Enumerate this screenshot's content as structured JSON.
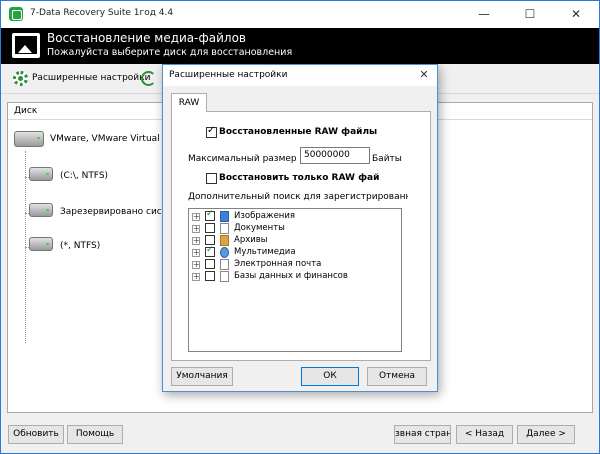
{
  "window": {
    "title": "7-Data Recovery Suite 1год 4.4",
    "minimize": "—",
    "maximize": "☐",
    "close": "✕"
  },
  "header": {
    "title": "Восстановление медиа-файлов",
    "subtitle": "Пожалуйста выберите диск для восстановления"
  },
  "toolbar": {
    "advanced_label": "Расширенные настройки"
  },
  "disk_panel": {
    "column_header": "Диск",
    "disks": [
      {
        "label": "VMware,  VMware Virtual S",
        "type": "physical"
      },
      {
        "label": "(C:\\, NTFS)",
        "type": "partition"
      },
      {
        "label": "Зарезервировано систем",
        "type": "partition"
      },
      {
        "label": "(*, NTFS)",
        "type": "partition"
      }
    ]
  },
  "buttons": {
    "update": "Обновить",
    "help": "Помощь",
    "home": "звная страни",
    "back": "< Назад",
    "next": "Далее >"
  },
  "dialog": {
    "title": "Расширенные настройки",
    "close": "✕",
    "tab": "RAW",
    "recover_raw_label": "Восстановленные RAW файлы",
    "recover_raw_checked": true,
    "max_size_label": "Максимальный размер",
    "max_size_value": "50000000",
    "max_size_unit": "Байты",
    "raw_only_label": "Восстановить только RAW фай",
    "raw_only_checked": false,
    "extra_search_label": "Дополнительный поиск для зарегистрированных типов файлов:",
    "file_types": [
      {
        "label": "Изображения",
        "checked": true,
        "icon": "image-icon"
      },
      {
        "label": "Документы",
        "checked": false,
        "icon": "document-icon"
      },
      {
        "label": "Архивы",
        "checked": false,
        "icon": "archive-icon"
      },
      {
        "label": "Мультимедиа",
        "checked": true,
        "icon": "media-icon"
      },
      {
        "label": "Электронная почта",
        "checked": false,
        "icon": "email-icon"
      },
      {
        "label": "Базы данных и финансов",
        "checked": false,
        "icon": "database-icon"
      }
    ],
    "default_button": "Умолчания",
    "ok_button": "ОК",
    "cancel_button": "Отмена"
  }
}
